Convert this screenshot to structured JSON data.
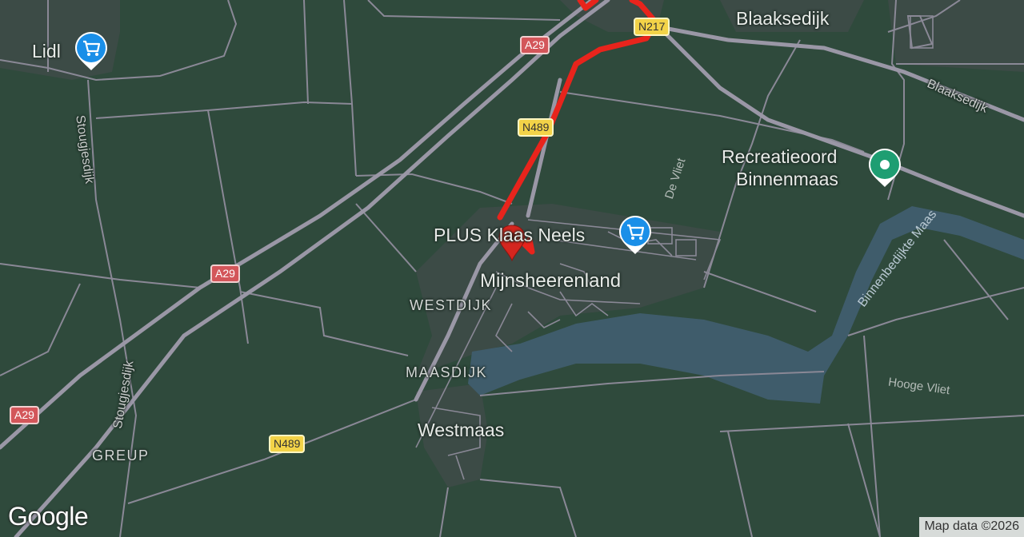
{
  "map": {
    "colors": {
      "land": "#2f4a3c",
      "built_up": "#3c4b46",
      "water": "#3f5c6b",
      "road": "#8c8b98",
      "major_road": "#9895a3",
      "route": "#e8241c"
    },
    "places": {
      "town_1": "Mijnsheerenland",
      "town_2": "Westmaas",
      "hamlet": "Blaaksedijk",
      "district_1": "WESTDIJK",
      "district_2": "MAASDIJK",
      "district_3": "GREUP"
    },
    "streets": {
      "s1": "Stougjesdijk",
      "s2": "Stougjesdijk",
      "s3": "Blaaksedijk"
    },
    "water_labels": {
      "w1": "Binnenbedijkte Maas",
      "w2": "De Vliet",
      "w3": "Hooge Vliet"
    },
    "shields": {
      "a29_1": "A29",
      "a29_2": "A29",
      "a29_3": "A29",
      "n217": "N217",
      "n489_1": "N489",
      "n489_2": "N489"
    },
    "pois": {
      "lidl": {
        "label": "Lidl",
        "icon": "shopping-cart-icon"
      },
      "plus": {
        "label": "PLUS Klaas Neels",
        "icon": "shopping-cart-icon"
      },
      "recreatie": {
        "label_line1": "Recreatieoord",
        "label_line2": "Binnenmaas",
        "icon": "park-icon"
      }
    },
    "logo": "Google",
    "attribution": "Map data ©2026"
  }
}
